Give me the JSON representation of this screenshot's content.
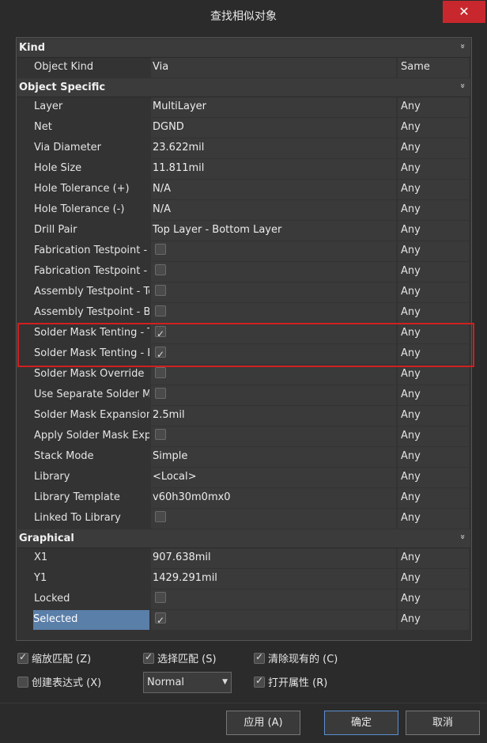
{
  "window": {
    "title": "查找相似对象",
    "close_glyph": "✕"
  },
  "categories": {
    "kind": "Kind",
    "object_specific": "Object Specific",
    "graphical": "Graphical"
  },
  "kind_rows": [
    {
      "name": "Object Kind",
      "value": "Via",
      "compare": "Same"
    }
  ],
  "specific_rows": [
    {
      "name": "Layer",
      "value": "MultiLayer",
      "compare": "Any"
    },
    {
      "name": "Net",
      "value": "DGND",
      "compare": "Any"
    },
    {
      "name": "Via Diameter",
      "value": "23.622mil",
      "compare": "Any"
    },
    {
      "name": "Hole Size",
      "value": "11.811mil",
      "compare": "Any"
    },
    {
      "name": "Hole Tolerance (+)",
      "value": "N/A",
      "compare": "Any"
    },
    {
      "name": "Hole Tolerance (-)",
      "value": "N/A",
      "compare": "Any"
    },
    {
      "name": "Drill Pair",
      "value": "Top Layer - Bottom Layer",
      "compare": "Any"
    },
    {
      "name": "Fabrication Testpoint - T",
      "checkbox": false,
      "compare": "Any"
    },
    {
      "name": "Fabrication Testpoint - B",
      "checkbox": false,
      "compare": "Any"
    },
    {
      "name": "Assembly Testpoint - To",
      "checkbox": false,
      "compare": "Any"
    },
    {
      "name": "Assembly Testpoint - Bo",
      "checkbox": false,
      "compare": "Any"
    },
    {
      "name": "Solder Mask Tenting - T",
      "checkbox": true,
      "compare": "Any"
    },
    {
      "name": "Solder Mask Tenting - B",
      "checkbox": true,
      "compare": "Any"
    },
    {
      "name": "Solder Mask Override",
      "checkbox": false,
      "compare": "Any"
    },
    {
      "name": "Use Separate Solder Ma",
      "checkbox": false,
      "compare": "Any"
    },
    {
      "name": "Solder Mask Expansion",
      "value": "2.5mil",
      "compare": "Any"
    },
    {
      "name": "Apply Solder Mask Expa",
      "checkbox": false,
      "compare": "Any"
    },
    {
      "name": "Stack Mode",
      "value": "Simple",
      "compare": "Any"
    },
    {
      "name": "Library",
      "value": "<Local>",
      "compare": "Any"
    },
    {
      "name": "Library Template",
      "value": "v60h30m0mx0",
      "compare": "Any"
    },
    {
      "name": "Linked To Library",
      "checkbox": false,
      "compare": "Any"
    }
  ],
  "graphical_rows": [
    {
      "name": "X1",
      "value": "907.638mil",
      "compare": "Any"
    },
    {
      "name": "Y1",
      "value": "1429.291mil",
      "compare": "Any"
    },
    {
      "name": "Locked",
      "checkbox": false,
      "compare": "Any"
    },
    {
      "name": "Selected",
      "checkbox": true,
      "compare": "Any",
      "selected": true
    }
  ],
  "options": {
    "zoom_match": {
      "label": "缩放匹配 (Z)",
      "checked": true
    },
    "select_match": {
      "label": "选择匹配 (S)",
      "checked": true
    },
    "clear_existing": {
      "label": "清除现有的 (C)",
      "checked": true
    },
    "create_expression": {
      "label": "创建表达式 (X)",
      "checked": false
    },
    "open_properties": {
      "label": "打开属性 (R)",
      "checked": true
    },
    "mode_select": {
      "value": "Normal"
    }
  },
  "buttons": {
    "apply": "应用 (A)",
    "ok": "确定",
    "cancel": "取消"
  },
  "colors": {
    "highlight": "#d02020",
    "selected_row": "#5a7fa8",
    "close": "#c8282d"
  }
}
